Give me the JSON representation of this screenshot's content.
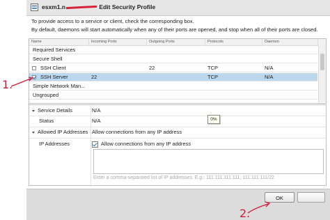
{
  "dialog": {
    "title_prefix": "esxm1.n",
    "title_suffix": "Edit Security Profile"
  },
  "intro": {
    "line1": "To provide access to a service or client, check the corresponding box.",
    "line2": "By default, daemons will start automatically when any of their ports are opened, and stop when all of their ports are closed."
  },
  "table": {
    "headers": [
      "Name",
      "Incoming Ports",
      "Outgoing Ports",
      "Protocols",
      "Daemon"
    ],
    "rows": [
      {
        "name": "Required Services",
        "incoming": "",
        "outgoing": "",
        "protocols": "",
        "daemon": ""
      },
      {
        "name": "Secure Shell",
        "incoming": "",
        "outgoing": "",
        "protocols": "",
        "daemon": ""
      },
      {
        "name": "SSH Client",
        "incoming": "",
        "outgoing": "22",
        "protocols": "TCP",
        "daemon": "N/A",
        "checked": false
      },
      {
        "name": "SSH Server",
        "incoming": "22",
        "outgoing": "",
        "protocols": "TCP",
        "daemon": "N/A",
        "checked": true
      },
      {
        "name": "Simple Network Man...",
        "incoming": "",
        "outgoing": "",
        "protocols": "",
        "daemon": ""
      },
      {
        "name": "Ungrouped",
        "incoming": "",
        "outgoing": "",
        "protocols": "",
        "daemon": ""
      }
    ]
  },
  "details": {
    "service_details_label": "Service Details",
    "service_details_value": "N/A",
    "status_label": "Status",
    "status_value": "N/A",
    "progress_tooltip": "0%",
    "allowed_ip_label": "Allowed IP Addresses",
    "allowed_ip_value": "Allow connections from any IP address",
    "ip_addresses_label": "IP Addresses",
    "allow_any_checkbox_label": "Allow connections from any IP address",
    "allow_any_checked": true,
    "ip_list_placeholder": "Enter a comma-separated list of IP addresses. E.g.: 111.111.111.111, 111.111.111/22"
  },
  "footer": {
    "ok_label": "OK"
  },
  "annotations": {
    "step1": "1.",
    "step2": "2.",
    "color": "#d4193a"
  }
}
